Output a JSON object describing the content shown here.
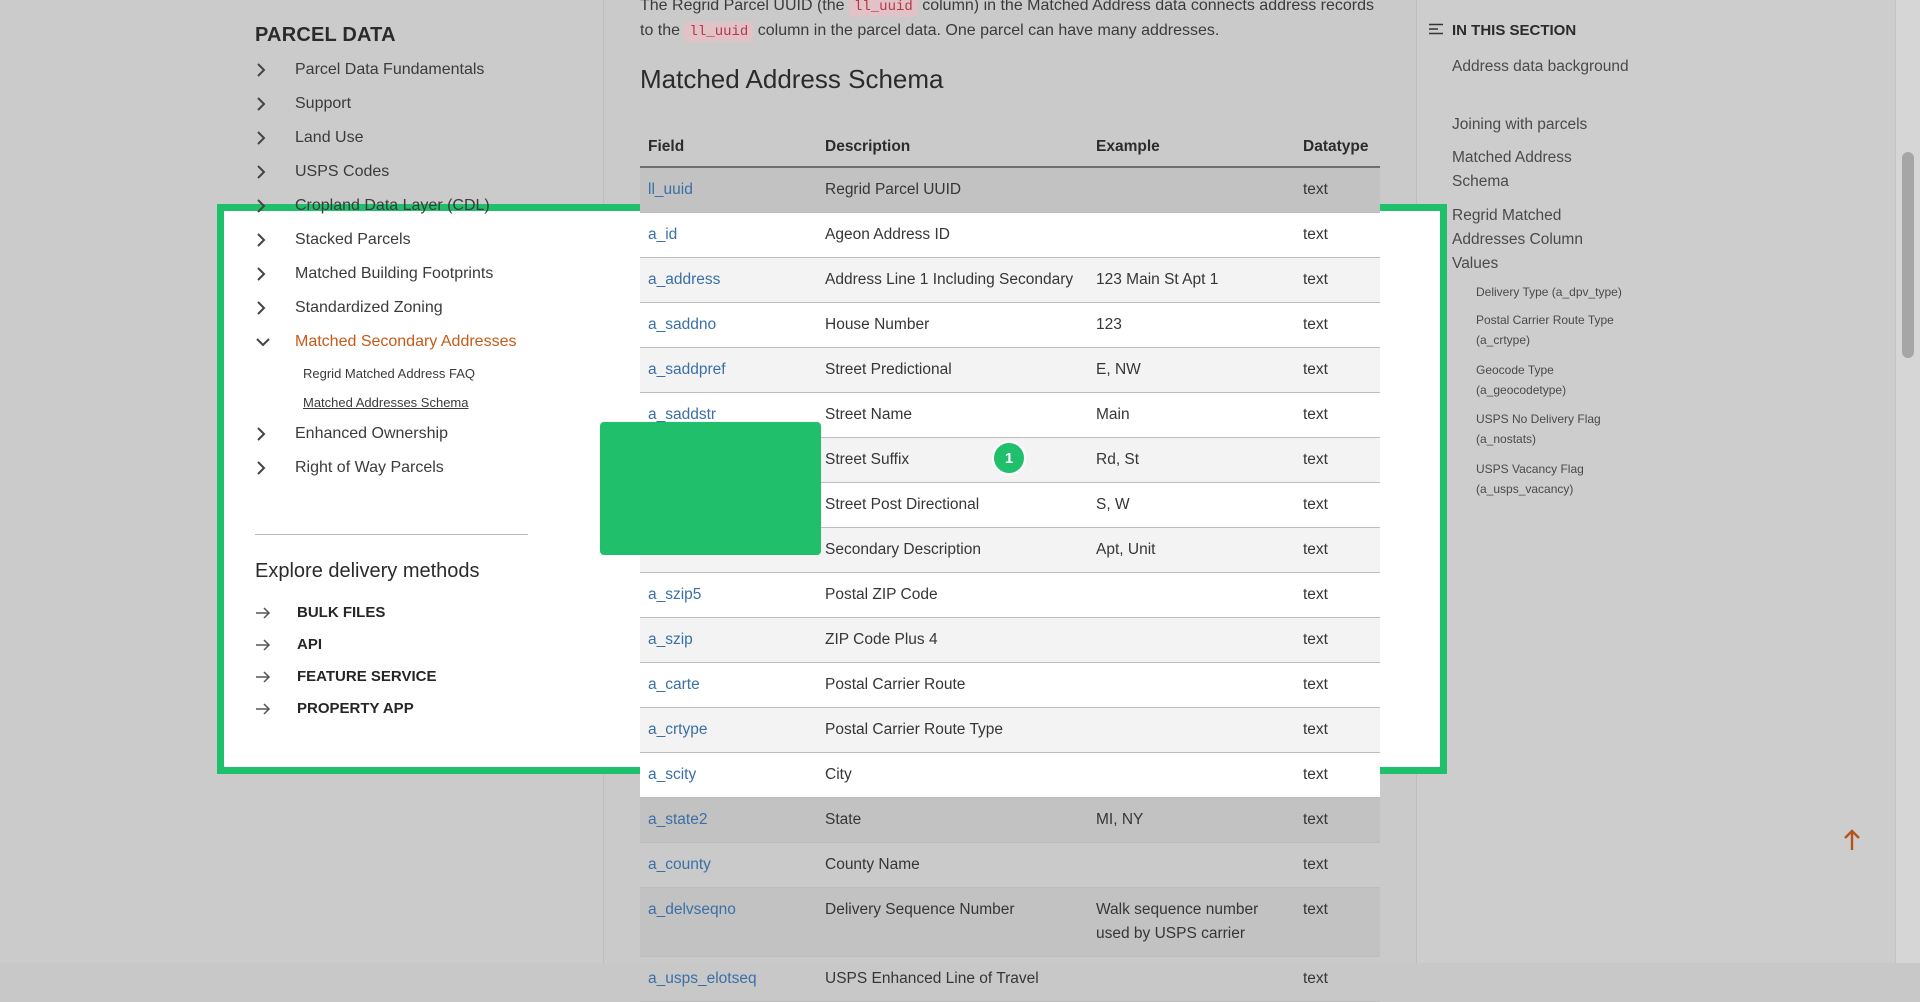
{
  "left_nav": {
    "title": "PARCEL DATA",
    "items": [
      {
        "label": "Parcel Data Fundamentals"
      },
      {
        "label": "Support"
      },
      {
        "label": "Land Use"
      },
      {
        "label": "USPS Codes"
      },
      {
        "label": "Cropland Data Layer (CDL)"
      },
      {
        "label": "Stacked Parcels"
      },
      {
        "label": "Matched Building Footprints"
      },
      {
        "label": "Standardized Zoning"
      },
      {
        "label": "Matched Secondary Addresses"
      },
      {
        "label": "Enhanced Ownership"
      },
      {
        "label": "Right of Way Parcels"
      }
    ],
    "sub_items": [
      {
        "label": "Regrid Matched Address FAQ"
      },
      {
        "label": "Matched Addresses Schema"
      }
    ],
    "explore_title": "Explore delivery methods",
    "methods": [
      {
        "label": "BULK FILES"
      },
      {
        "label": "API"
      },
      {
        "label": "FEATURE SERVICE"
      },
      {
        "label": "PROPERTY APP"
      }
    ]
  },
  "main": {
    "intro_part1": "The Regrid Parcel UUID (the ",
    "intro_code1": "ll_uuid",
    "intro_part2": " column) in the Matched Address data connects address records to the ",
    "intro_code2": "ll_uuid",
    "intro_part3": " column in the parcel data. One parcel can have many addresses.",
    "heading": "Matched Address Schema",
    "columns": [
      "Field",
      "Description",
      "Example",
      "Datatype"
    ],
    "rows": [
      {
        "field": "ll_uuid",
        "description": "Regrid Parcel UUID",
        "example": "",
        "datatype": "text"
      },
      {
        "field": "a_id",
        "description": "Ageon Address ID",
        "example": "",
        "datatype": "text"
      },
      {
        "field": "a_address",
        "description": "Address Line 1 Including Secondary",
        "example": "123 Main St Apt 1",
        "datatype": "text"
      },
      {
        "field": "a_saddno",
        "description": "House Number",
        "example": "123",
        "datatype": "text"
      },
      {
        "field": "a_saddpref",
        "description": "Street Predictional",
        "example": "E, NW",
        "datatype": "text"
      },
      {
        "field": "a_saddstr",
        "description": "Street Name",
        "example": "Main",
        "datatype": "text"
      },
      {
        "field": "",
        "description": "Street Suffix",
        "example": "Rd, St",
        "datatype": "text"
      },
      {
        "field": "",
        "description": "Street Post Directional",
        "example": "S, W",
        "datatype": "text"
      },
      {
        "field": "",
        "description": "Secondary Description",
        "example": "Apt, Unit",
        "datatype": "text"
      },
      {
        "field": "a_szip5",
        "description": "Postal ZIP Code",
        "example": "",
        "datatype": "text"
      },
      {
        "field": "a_szip",
        "description": "ZIP Code Plus 4",
        "example": "",
        "datatype": "text"
      },
      {
        "field": "a_carte",
        "description": "Postal Carrier Route",
        "example": "",
        "datatype": "text"
      },
      {
        "field": "a_crtype",
        "description": "Postal Carrier Route Type",
        "example": "",
        "datatype": "text"
      },
      {
        "field": "a_scity",
        "description": "City",
        "example": "",
        "datatype": "text"
      },
      {
        "field": "a_state2",
        "description": "State",
        "example": "MI, NY",
        "datatype": "text"
      },
      {
        "field": "a_county",
        "description": "County Name",
        "example": "",
        "datatype": "text"
      },
      {
        "field": "a_delvseqno",
        "description": "Delivery Sequence Number",
        "example": "Walk sequence number used by USPS carrier",
        "datatype": "text"
      },
      {
        "field": "a_usps_elotseq",
        "description": "USPS Enhanced Line of Travel",
        "example": "",
        "datatype": "text"
      }
    ]
  },
  "toc": {
    "title": "IN THIS SECTION",
    "items": [
      {
        "label": "Address data background"
      },
      {
        "label": "Joining with parcels"
      },
      {
        "label": "Matched Address Schema"
      },
      {
        "label": "Regrid Matched Addresses Column Values"
      }
    ],
    "sub_items": [
      {
        "label": "Delivery Type (a_dpv_type)"
      },
      {
        "label": "Postal Carrier Route Type (a_crtype)"
      },
      {
        "label": "Geocode Type (a_geocodetype)"
      },
      {
        "label": "USPS No Delivery Flag (a_nostats)"
      },
      {
        "label": "USPS Vacancy Flag (a_usps_vacancy)"
      }
    ]
  },
  "overlay": {
    "badge": "1",
    "accent_color": "#1fbf6b",
    "link_color": "#3b6fa6",
    "active_color": "#c65a19"
  }
}
